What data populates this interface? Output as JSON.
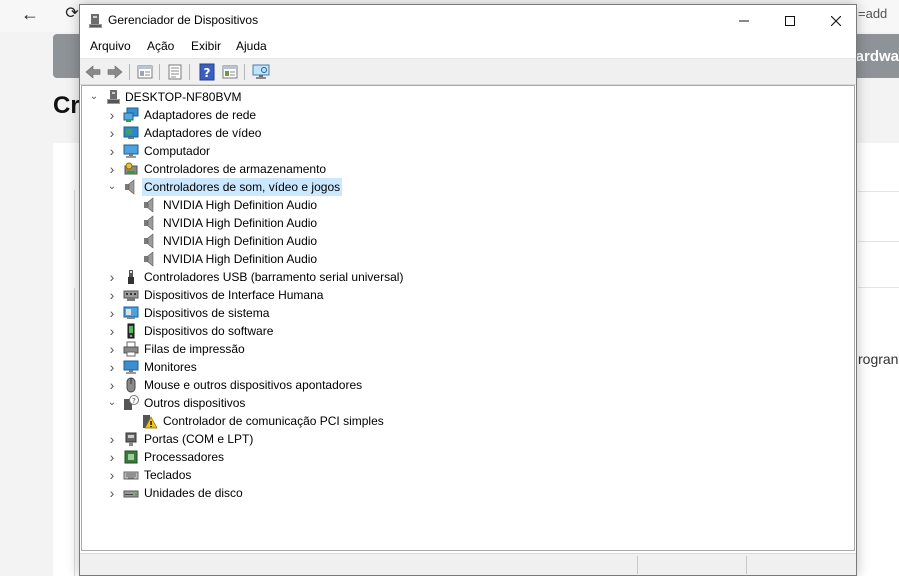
{
  "background": {
    "url_fragment": "=add",
    "banner_text": "ardwa",
    "page_title_fragment": "Cr",
    "side_text_fragment": "rogran"
  },
  "window": {
    "title": "Gerenciador de Dispositivos",
    "controls": {
      "minimize": "—",
      "maximize": "☐",
      "close": "✕"
    }
  },
  "menu": [
    "Arquivo",
    "Ação",
    "Exibir",
    "Ajuda"
  ],
  "toolbar": [
    "back-icon",
    "forward-icon",
    "properties-icon",
    "update-driver-icon",
    "help-icon",
    "view-icon",
    "scan-hardware-icon"
  ],
  "tree": {
    "root": "DESKTOP-NF80BVM",
    "items": [
      {
        "label": "Adaptadores de rede",
        "icon": "network-adapter-icon",
        "expanded": false
      },
      {
        "label": "Adaptadores de vídeo",
        "icon": "display-adapter-icon",
        "expanded": false
      },
      {
        "label": "Computador",
        "icon": "computer-icon",
        "expanded": false
      },
      {
        "label": "Controladores de armazenamento",
        "icon": "storage-controller-icon",
        "expanded": false
      },
      {
        "label": "Controladores de som, vídeo e jogos",
        "icon": "speaker-icon",
        "expanded": true,
        "selected": true,
        "children": [
          {
            "label": "NVIDIA High Definition Audio",
            "icon": "speaker-icon"
          },
          {
            "label": "NVIDIA High Definition Audio",
            "icon": "speaker-icon"
          },
          {
            "label": "NVIDIA High Definition Audio",
            "icon": "speaker-icon"
          },
          {
            "label": "NVIDIA High Definition Audio",
            "icon": "speaker-icon"
          }
        ]
      },
      {
        "label": "Controladores USB (barramento serial universal)",
        "icon": "usb-icon",
        "expanded": false
      },
      {
        "label": "Dispositivos de Interface Humana",
        "icon": "hid-icon",
        "expanded": false
      },
      {
        "label": "Dispositivos de sistema",
        "icon": "system-device-icon",
        "expanded": false
      },
      {
        "label": "Dispositivos do software",
        "icon": "software-device-icon",
        "expanded": false
      },
      {
        "label": "Filas de impressão",
        "icon": "printer-icon",
        "expanded": false
      },
      {
        "label": "Monitores",
        "icon": "monitor-icon",
        "expanded": false
      },
      {
        "label": "Mouse e outros dispositivos apontadores",
        "icon": "mouse-icon",
        "expanded": false
      },
      {
        "label": "Outros dispositivos",
        "icon": "unknown-device-icon",
        "expanded": true,
        "children": [
          {
            "label": "Controlador de comunicação PCI simples",
            "icon": "warning-device-icon"
          }
        ]
      },
      {
        "label": "Portas (COM e LPT)",
        "icon": "port-icon",
        "expanded": false
      },
      {
        "label": "Processadores",
        "icon": "processor-icon",
        "expanded": false
      },
      {
        "label": "Teclados",
        "icon": "keyboard-icon",
        "expanded": false
      },
      {
        "label": "Unidades de disco",
        "icon": "disk-drive-icon",
        "expanded": false
      }
    ]
  },
  "colors": {
    "selection": "#cce8ff",
    "accent": "#0078d7"
  }
}
